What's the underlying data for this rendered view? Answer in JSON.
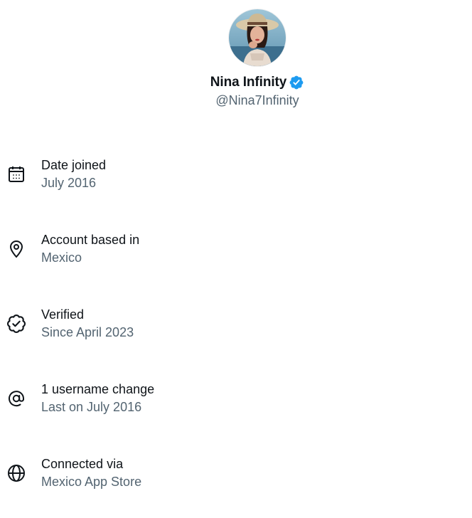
{
  "profile": {
    "display_name": "Nina Infinity",
    "handle": "@Nina7Infinity",
    "verified": true,
    "accent_color": "#1d9bf0"
  },
  "info": [
    {
      "icon": "calendar-icon",
      "label": "Date joined",
      "value": "July 2016"
    },
    {
      "icon": "location-pin-icon",
      "label": "Account based in",
      "value": "Mexico"
    },
    {
      "icon": "verified-check-icon",
      "label": "Verified",
      "value": "Since April 2023"
    },
    {
      "icon": "at-sign-icon",
      "label": "1 username change",
      "value": "Last on July 2016"
    },
    {
      "icon": "globe-icon",
      "label": "Connected via",
      "value": "Mexico App Store"
    }
  ],
  "colors": {
    "primary_text": "#0f1419",
    "secondary_text": "#536471",
    "badge_blue": "#1d9bf0"
  }
}
